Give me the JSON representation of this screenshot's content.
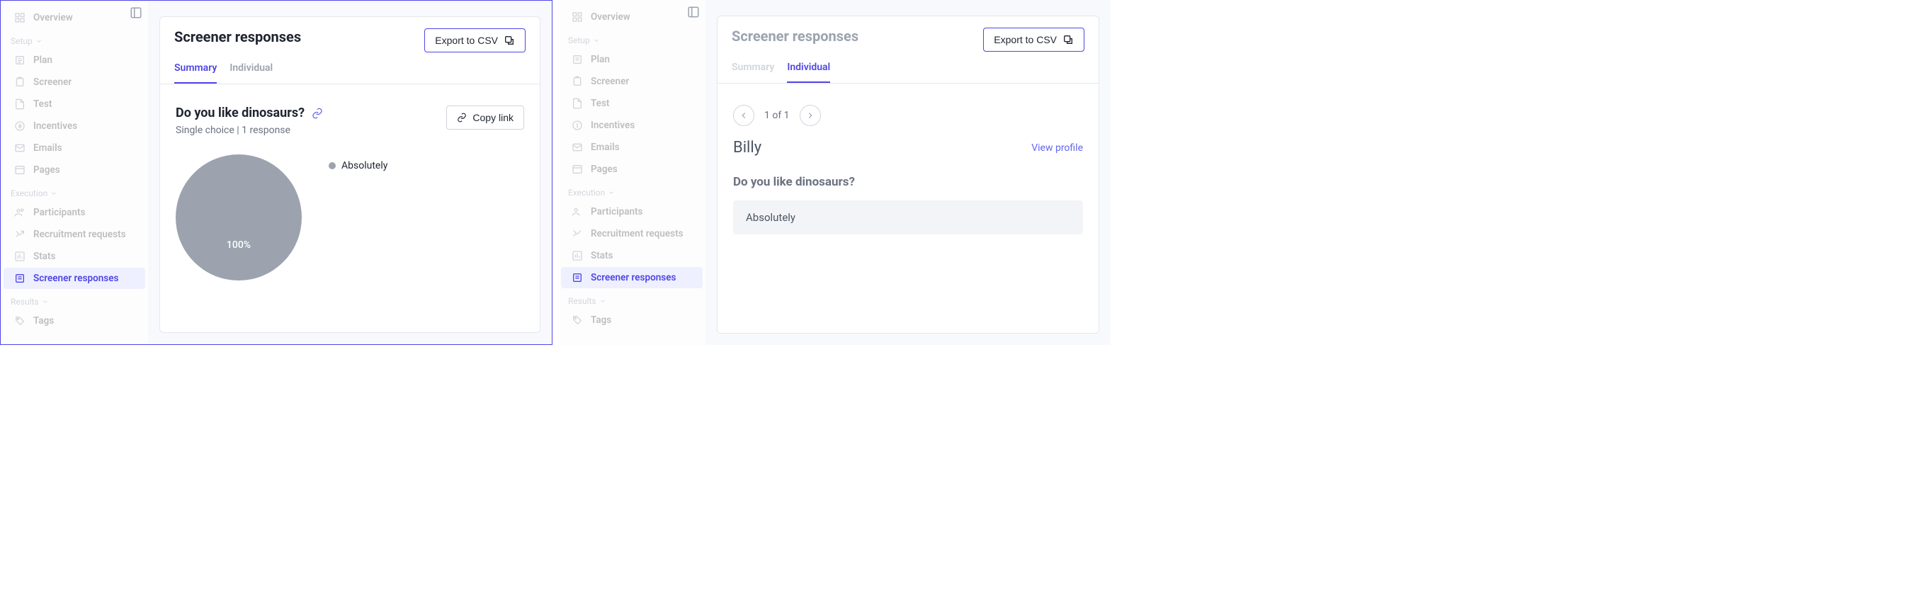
{
  "sidebar": {
    "overview": "Overview",
    "section_setup": "Setup",
    "plan": "Plan",
    "screener": "Screener",
    "test": "Test",
    "incentives": "Incentives",
    "emails": "Emails",
    "pages": "Pages",
    "section_execution": "Execution",
    "participants": "Participants",
    "recruitment": "Recruitment requests",
    "stats": "Stats",
    "screener_responses": "Screener responses",
    "section_results": "Results",
    "tags": "Tags"
  },
  "header": {
    "title": "Screener responses",
    "export": "Export to CSV"
  },
  "tabs": {
    "summary": "Summary",
    "individual": "Individual"
  },
  "summary": {
    "question": "Do you like dinosaurs?",
    "meta": "Single choice | 1 response",
    "copy": "Copy link",
    "pct": "100%",
    "legend": "Absolutely"
  },
  "individual": {
    "pager": "1 of 1",
    "name": "Billy",
    "view_profile": "View profile",
    "question": "Do you like dinosaurs?",
    "answer": "Absolutely"
  },
  "chart_data": {
    "type": "pie",
    "title": "Do you like dinosaurs?",
    "series": [
      {
        "name": "Absolutely",
        "value": 100
      }
    ]
  }
}
